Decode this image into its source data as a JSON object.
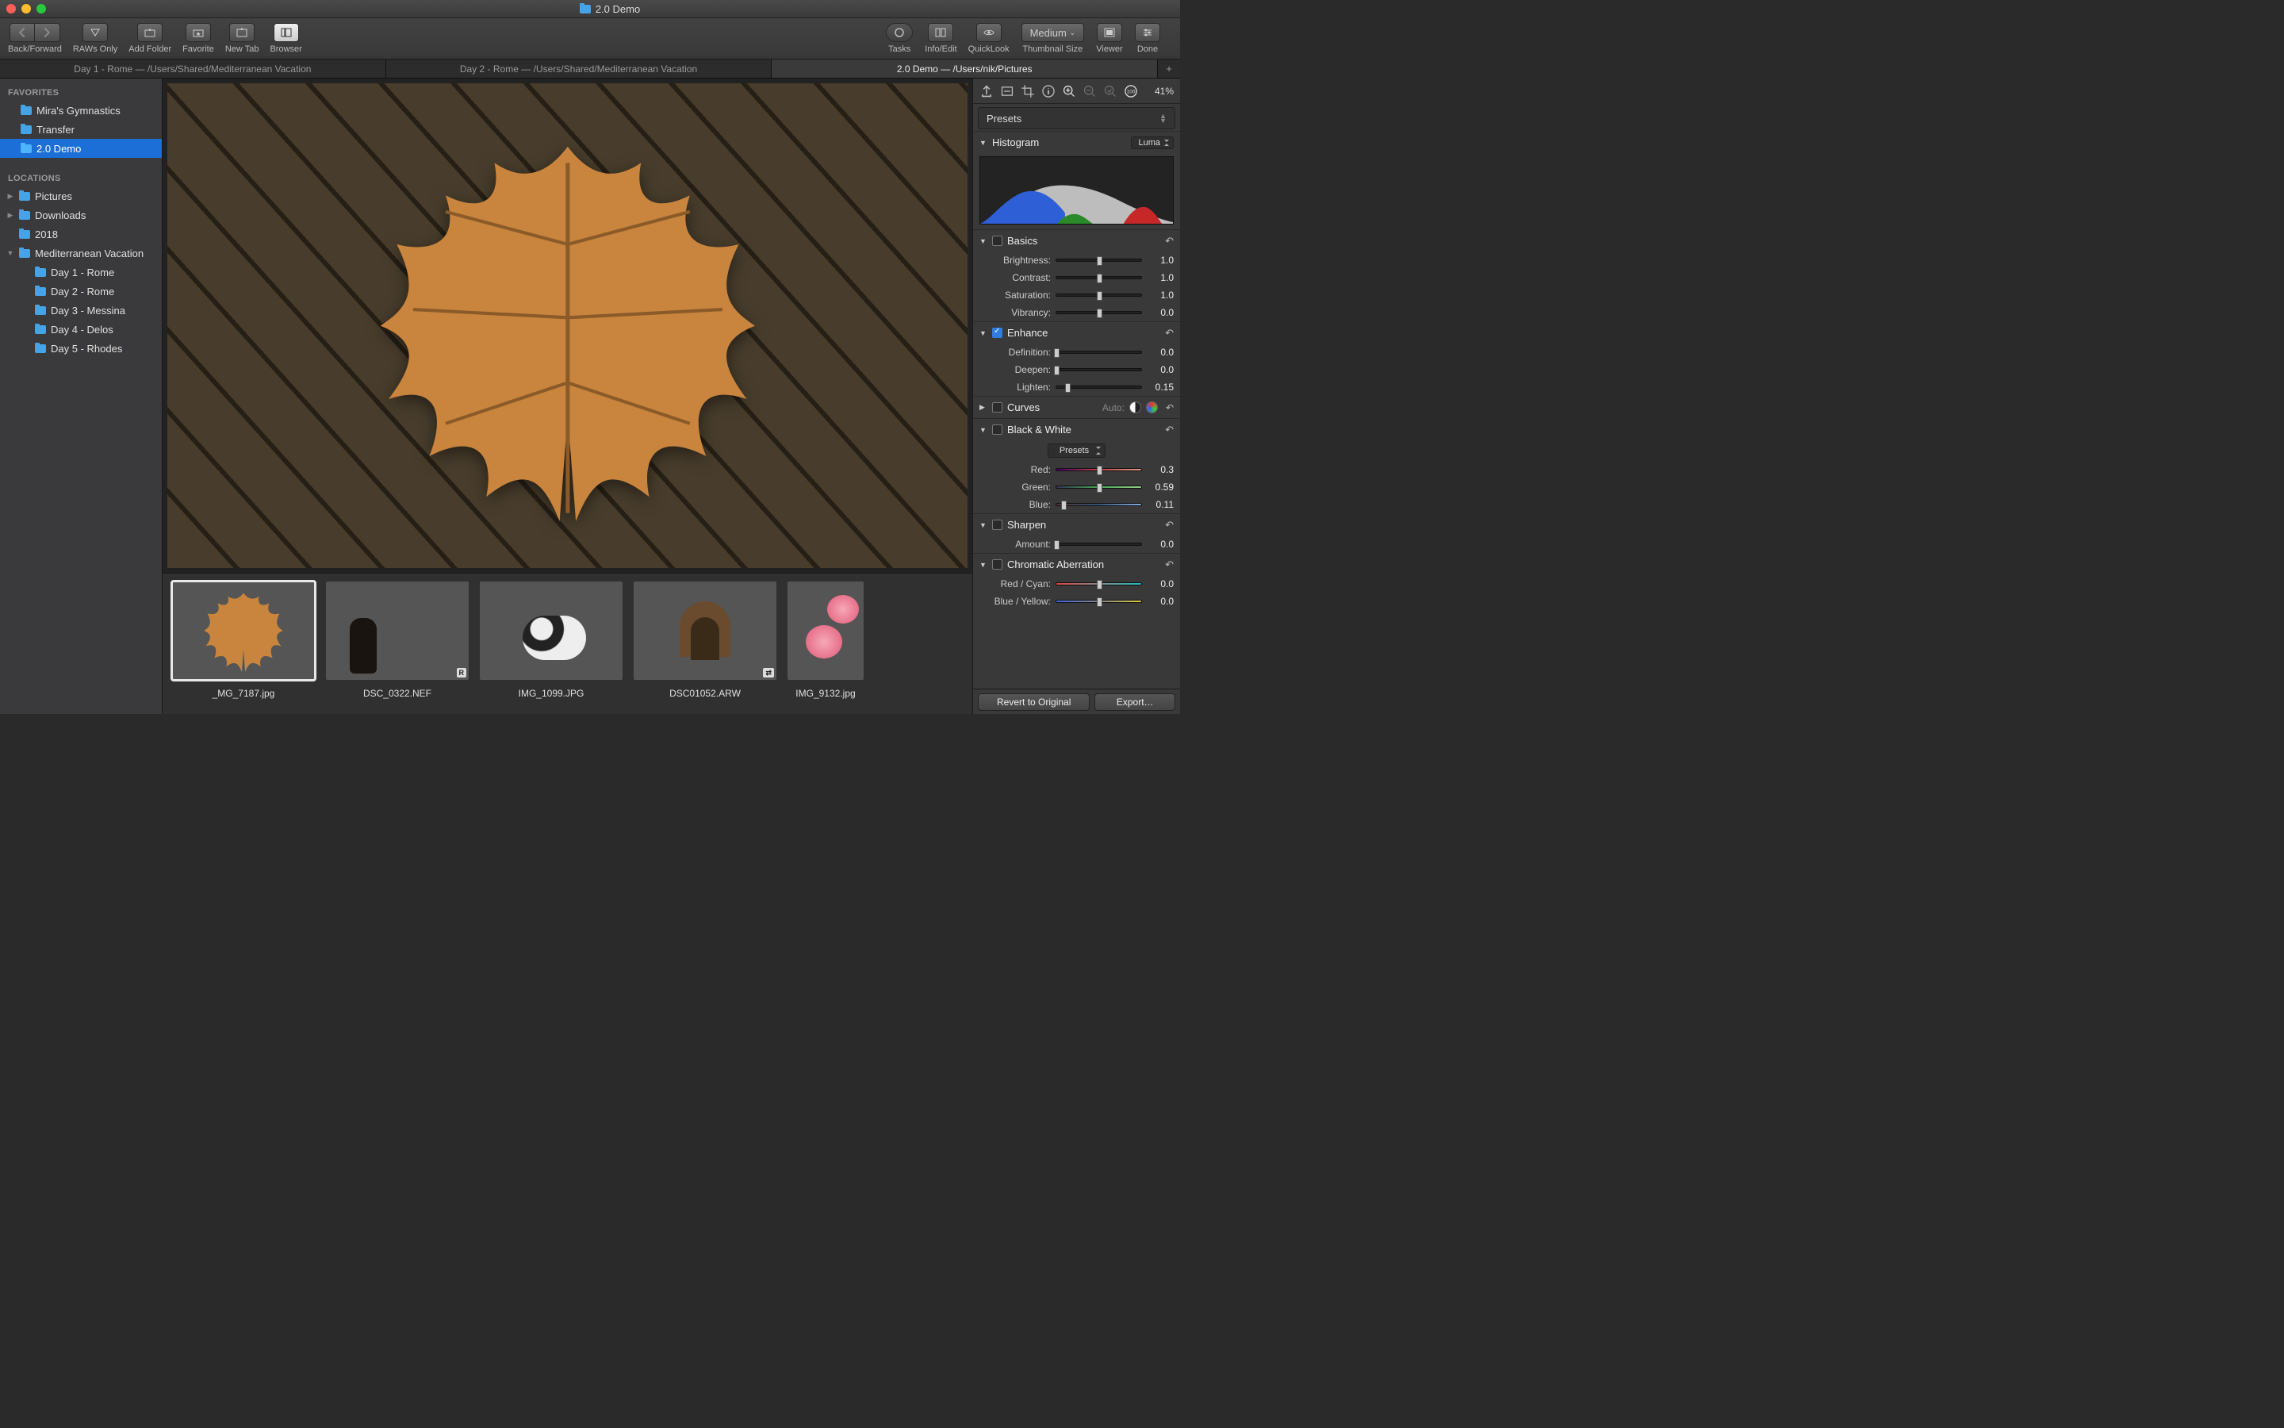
{
  "window_title": "2.0 Demo",
  "toolbar": {
    "back_forward": "Back/Forward",
    "raws_only": "RAWs Only",
    "add_folder": "Add Folder",
    "favorite": "Favorite",
    "new_tab": "New Tab",
    "browser": "Browser",
    "tasks": "Tasks",
    "info_edit": "Info/Edit",
    "quicklook": "QuickLook",
    "thumb_size": "Thumbnail Size",
    "thumb_size_value": "Medium",
    "viewer": "Viewer",
    "done": "Done"
  },
  "tabs": [
    {
      "label": "Day 1 - Rome  —  /Users/Shared/Mediterranean Vacation",
      "active": false
    },
    {
      "label": "Day 2 - Rome  —  /Users/Shared/Mediterranean Vacation",
      "active": false
    },
    {
      "label": "2.0 Demo  —  /Users/nik/Pictures",
      "active": true
    }
  ],
  "sidebar": {
    "favorites_header": "FAVORITES",
    "favorites": [
      {
        "name": "Mira's Gymnastics"
      },
      {
        "name": "Transfer"
      },
      {
        "name": "2.0 Demo",
        "selected": true
      }
    ],
    "locations_header": "LOCATIONS",
    "locations": [
      {
        "name": "Pictures",
        "disc": "▶"
      },
      {
        "name": "Downloads",
        "disc": "▶"
      },
      {
        "name": "2018",
        "disc": ""
      },
      {
        "name": "Mediterranean Vacation",
        "disc": "▼",
        "children": [
          "Day 1 - Rome",
          "Day 2 - Rome",
          "Day 3 - Messina",
          "Day 4 - Delos",
          "Day 5 - Rhodes"
        ]
      }
    ]
  },
  "thumbnails": [
    {
      "name": "_MG_7187.jpg",
      "scene": "sc-leaf",
      "selected": true
    },
    {
      "name": "DSC_0322.NEF",
      "scene": "sc-sunset",
      "badge": "R"
    },
    {
      "name": "IMG_1099.JPG",
      "scene": "sc-rabbit"
    },
    {
      "name": "DSC01052.ARW",
      "scene": "sc-arch",
      "badge": "⇄"
    },
    {
      "name": "IMG_9132.jpg",
      "scene": "sc-rose",
      "narrow": true
    }
  ],
  "inspector": {
    "zoom": "41%",
    "presets_label": "Presets",
    "histogram_label": "Histogram",
    "histogram_mode": "Luma",
    "basics": {
      "title": "Basics",
      "items": [
        {
          "label": "Brightness:",
          "value": "1.0",
          "pos": 50
        },
        {
          "label": "Contrast:",
          "value": "1.0",
          "pos": 50
        },
        {
          "label": "Saturation:",
          "value": "1.0",
          "pos": 50
        },
        {
          "label": "Vibrancy:",
          "value": "0.0",
          "pos": 50
        }
      ]
    },
    "enhance": {
      "title": "Enhance",
      "checked": true,
      "items": [
        {
          "label": "Definition:",
          "value": "0.0",
          "pos": 0
        },
        {
          "label": "Deepen:",
          "value": "0.0",
          "pos": 0
        },
        {
          "label": "Lighten:",
          "value": "0.15",
          "pos": 13
        }
      ]
    },
    "curves": {
      "title": "Curves",
      "auto_label": "Auto:"
    },
    "bw": {
      "title": "Black & White",
      "presets": "Presets",
      "items": [
        {
          "label": "Red:",
          "value": "0.3",
          "pos": 50,
          "grad": "grad-red"
        },
        {
          "label": "Green:",
          "value": "0.59",
          "pos": 50,
          "grad": "grad-green"
        },
        {
          "label": "Blue:",
          "value": "0.11",
          "pos": 8,
          "grad": "grad-blue"
        }
      ]
    },
    "sharpen": {
      "title": "Sharpen",
      "items": [
        {
          "label": "Amount:",
          "value": "0.0",
          "pos": 0
        }
      ]
    },
    "ca": {
      "title": "Chromatic Aberration",
      "items": [
        {
          "label": "Red / Cyan:",
          "value": "0.0",
          "pos": 50,
          "grad": "grad-rc"
        },
        {
          "label": "Blue / Yellow:",
          "value": "0.0",
          "pos": 50,
          "grad": "grad-by"
        }
      ]
    },
    "footer": {
      "revert": "Revert to Original",
      "export": "Export…"
    }
  }
}
